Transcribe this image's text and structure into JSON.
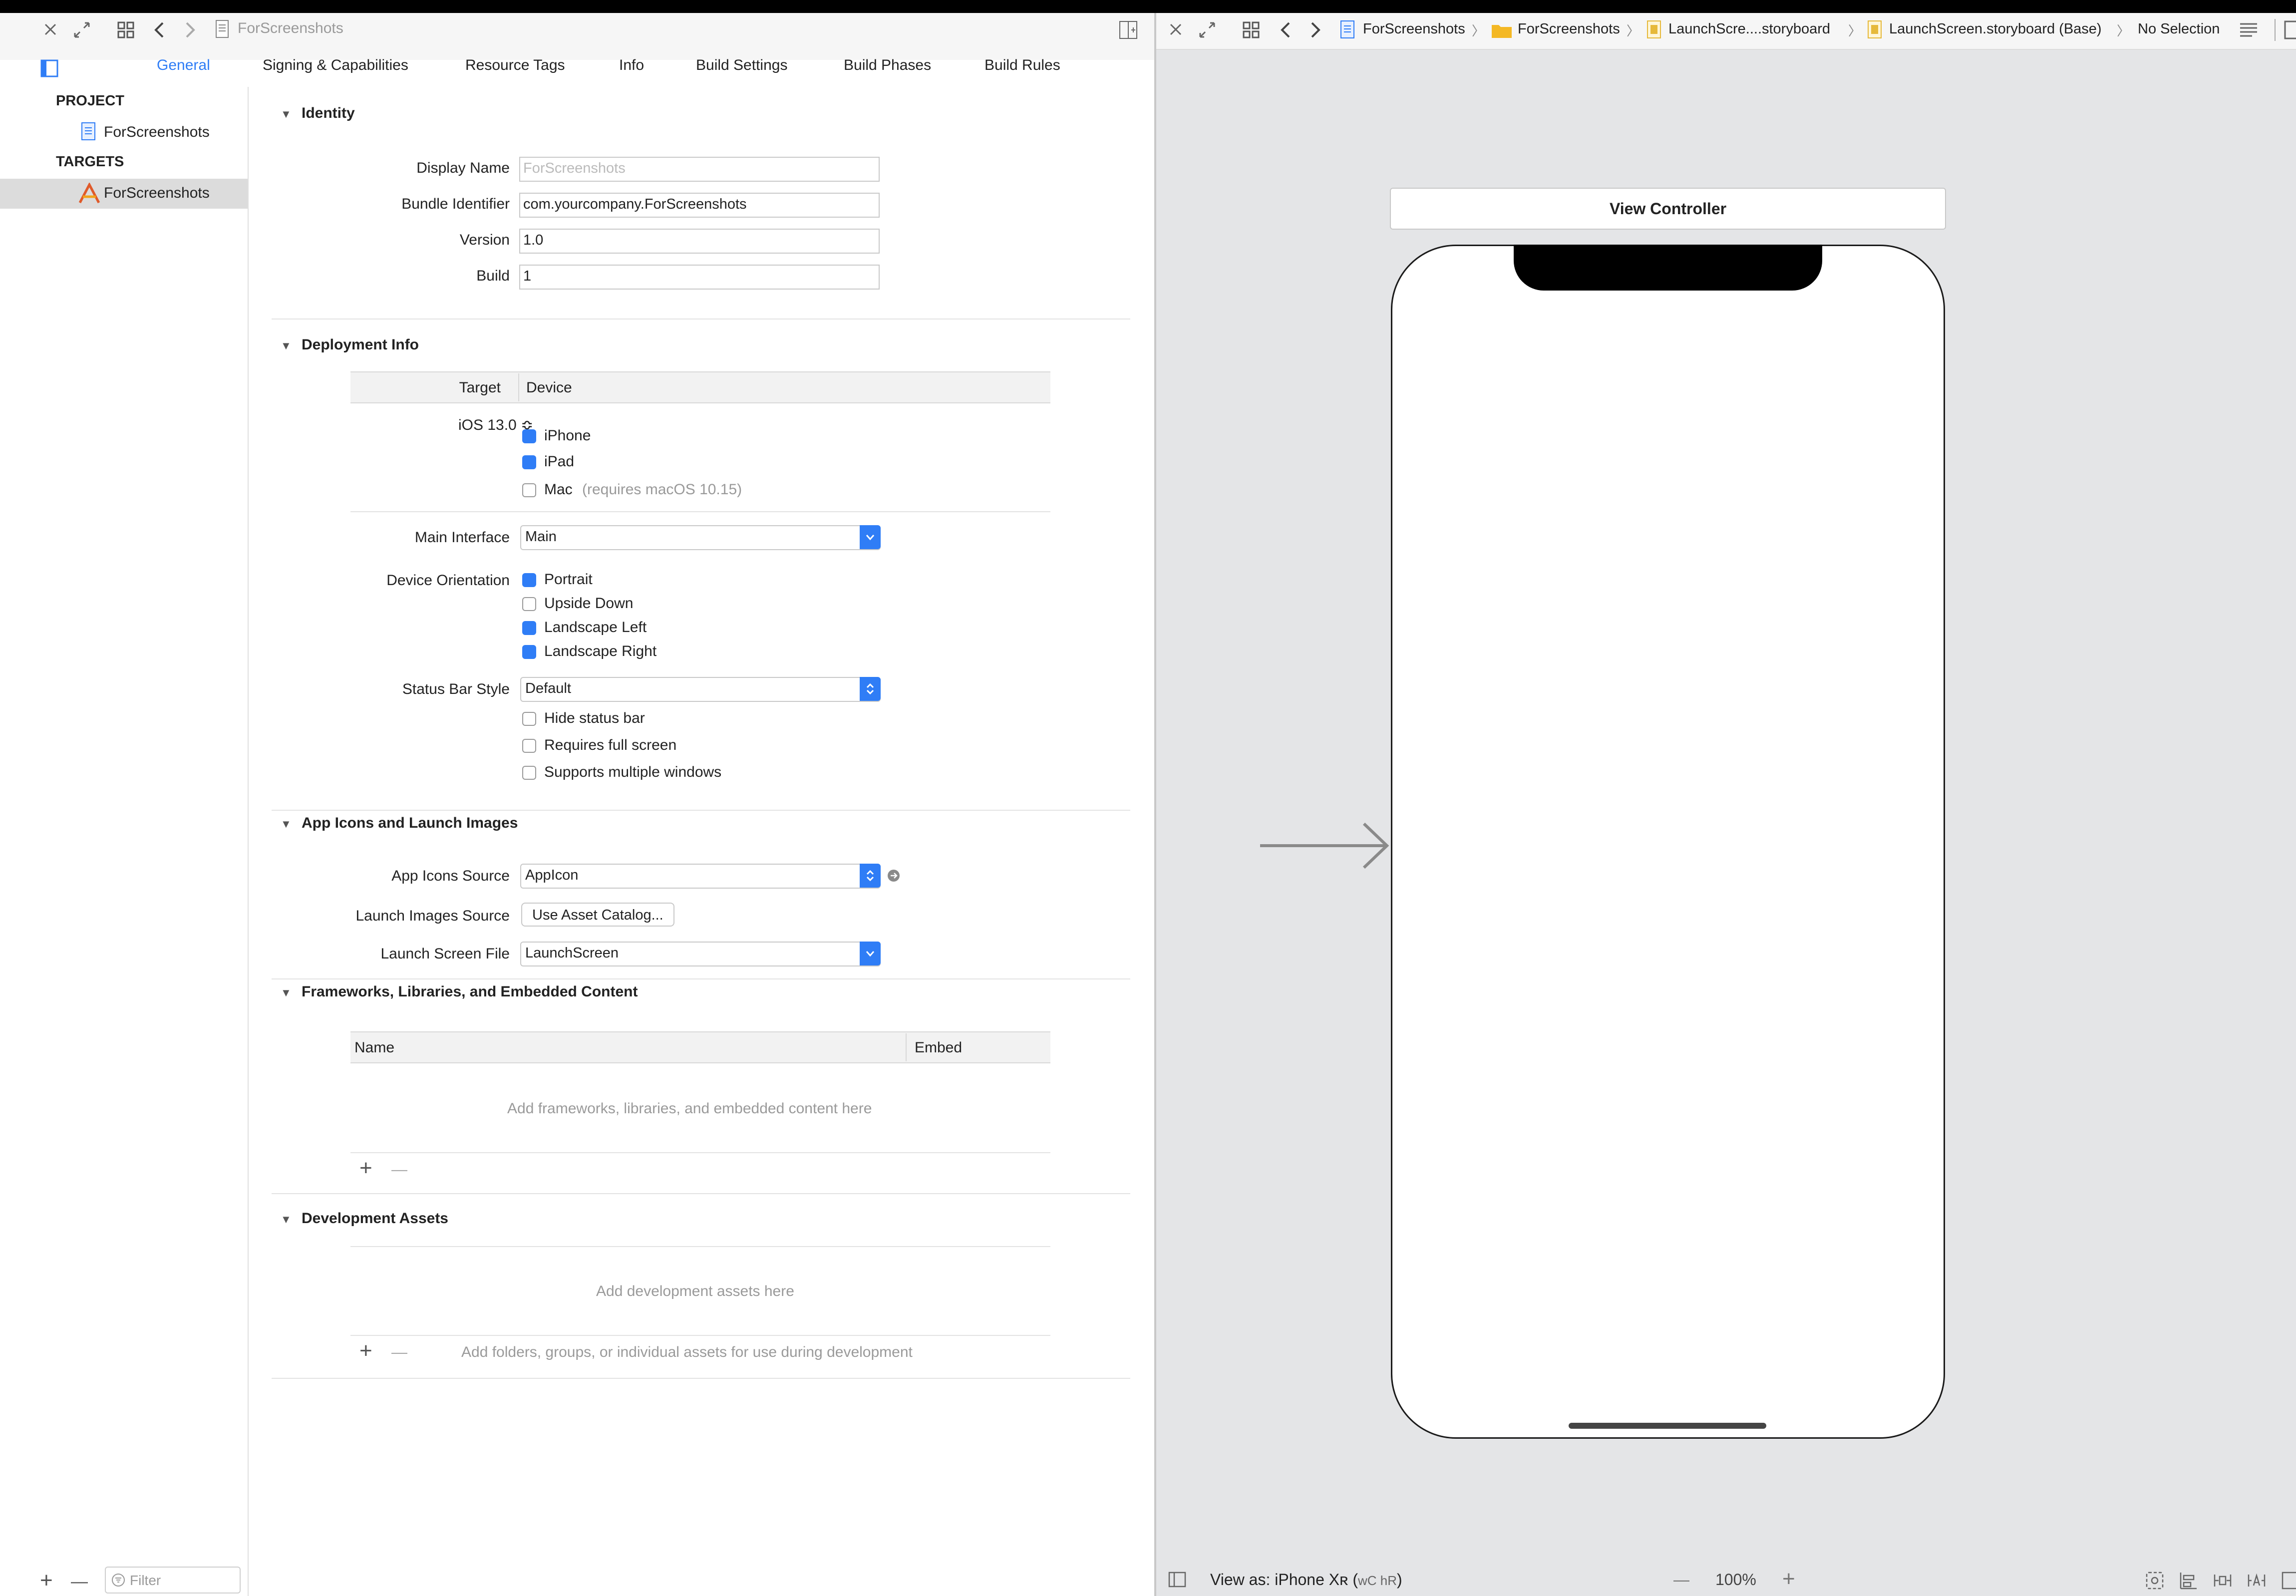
{
  "left_toolbar": {
    "file_name": "ForScreenshots"
  },
  "tabs": [
    "General",
    "Signing & Capabilities",
    "Resource Tags",
    "Info",
    "Build Settings",
    "Build Phases",
    "Build Rules"
  ],
  "sidebar": {
    "project_header": "PROJECT",
    "project_item": "ForScreenshots",
    "targets_header": "TARGETS",
    "target_item": "ForScreenshots",
    "filter_placeholder": "Filter"
  },
  "identity": {
    "title": "Identity",
    "display_name_label": "Display Name",
    "display_name_placeholder": "ForScreenshots",
    "bundle_id_label": "Bundle Identifier",
    "bundle_id_value": "com.yourcompany.ForScreenshots",
    "version_label": "Version",
    "version_value": "1.0",
    "build_label": "Build",
    "build_value": "1"
  },
  "deployment": {
    "title": "Deployment Info",
    "col_target": "Target",
    "col_device": "Device",
    "ios_version": "iOS 13.0",
    "stepper_glyph": "≎",
    "iphone": "iPhone",
    "ipad": "iPad",
    "mac": "Mac",
    "mac_note": "(requires macOS 10.15)",
    "main_interface_label": "Main Interface",
    "main_interface_value": "Main",
    "orientation_label": "Device Orientation",
    "portrait": "Portrait",
    "upside_down": "Upside Down",
    "landscape_left": "Landscape Left",
    "landscape_right": "Landscape Right",
    "status_bar_label": "Status Bar Style",
    "status_bar_value": "Default",
    "hide_status_bar": "Hide status bar",
    "requires_full_screen": "Requires full screen",
    "multiple_windows": "Supports multiple windows"
  },
  "app_icons": {
    "title": "App Icons and Launch Images",
    "icons_source_label": "App Icons Source",
    "icons_source_value": "AppIcon",
    "launch_images_label": "Launch Images Source",
    "launch_images_button": "Use Asset Catalog...",
    "launch_screen_label": "Launch Screen File",
    "launch_screen_value": "LaunchScreen"
  },
  "frameworks": {
    "title": "Frameworks, Libraries, and Embedded Content",
    "col_name": "Name",
    "col_embed": "Embed",
    "empty_text": "Add frameworks, libraries, and embedded content here"
  },
  "dev_assets": {
    "title": "Development Assets",
    "empty_text": "Add development assets here",
    "footer_text": "Add folders, groups, or individual assets for use during development"
  },
  "right_toolbar": {
    "crumb_project": "ForScreenshots",
    "crumb_folder": "ForScreenshots",
    "crumb_file": "LaunchScre....storyboard",
    "crumb_base": "LaunchScreen.storyboard (Base)",
    "crumb_selection": "No Selection"
  },
  "canvas": {
    "scene_title": "View Controller",
    "view_as": "View as: iPhone Xʀ (",
    "view_as_keys": "wC hR",
    "view_as_close": ")",
    "zoom": "100%",
    "zoom_out": "—",
    "zoom_in": "+"
  },
  "glyphs": {
    "separator": "〉",
    "chevron_left": "〈",
    "chevron_right": "〉",
    "plus": "+",
    "minus": "—",
    "triangle": "▼"
  },
  "colors": {
    "accent": "#2f7df6",
    "canvas_bg": "#e4e5e7",
    "folder": "#f4b824"
  }
}
